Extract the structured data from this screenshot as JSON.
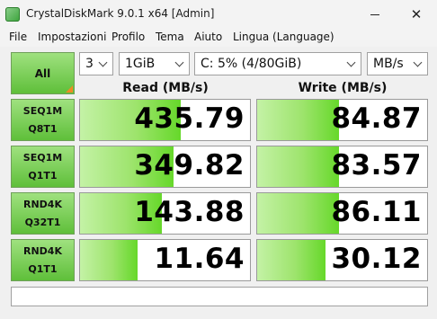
{
  "window": {
    "title": "CrystalDiskMark 9.0.1 x64 [Admin]",
    "icon": "crystaldiskmark-app-icon",
    "minimize_glyph": "—",
    "close_glyph": "✕"
  },
  "menu": [
    "File",
    "Impostazioni",
    "Profilo",
    "Tema",
    "Aiuto",
    "Lingua (Language)"
  ],
  "controls": {
    "all_label": "All",
    "count": "3",
    "size": "1GiB",
    "drive": "C: 5% (4/80GiB)",
    "unit": "MB/s"
  },
  "headers": {
    "read": "Read (MB/s)",
    "write": "Write (MB/s)"
  },
  "rows": [
    {
      "line1": "SEQ1M",
      "line2": "Q8T1",
      "read": "435.79",
      "write": "84.87",
      "read_fill": 0.59,
      "write_fill": 0.48
    },
    {
      "line1": "SEQ1M",
      "line2": "Q1T1",
      "read": "349.82",
      "write": "83.57",
      "read_fill": 0.55,
      "write_fill": 0.48
    },
    {
      "line1": "RND4K",
      "line2": "Q32T1",
      "read": "143.88",
      "write": "86.11",
      "read_fill": 0.48,
      "write_fill": 0.48
    },
    {
      "line1": "RND4K",
      "line2": "Q1T1",
      "read": "11.64",
      "write": "30.12",
      "read_fill": 0.34,
      "write_fill": 0.4
    }
  ],
  "status_text": "",
  "colors": {
    "button_green_top": "#9fe17f",
    "button_green_bottom": "#5fbf3a",
    "bar_green": "#66d82a",
    "corner_orange": "#f08a24"
  }
}
